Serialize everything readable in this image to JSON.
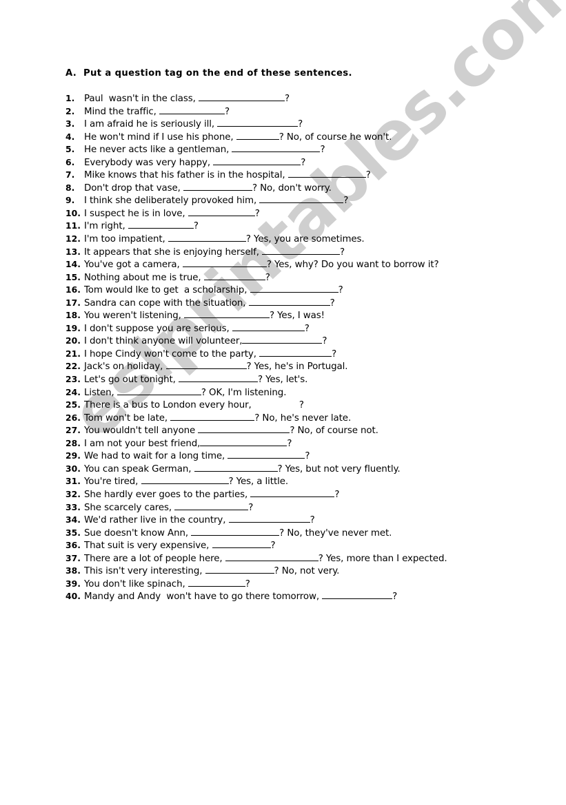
{
  "document": {
    "type": "worksheet",
    "background_color": "#ffffff",
    "text_color": "#000000"
  },
  "watermark": {
    "text": "eslprintables.com",
    "color": "#cfcfcf",
    "rotation_deg": -43,
    "style": "diagonal bold gray"
  },
  "heading": {
    "label": "A.  Put a question tag on the end of these sentences."
  },
  "questions": [
    {
      "num": "1.",
      "num_pad": "1.  ",
      "text": "Paul  wasn't in the class, ",
      "blank_width": 125,
      "tail": "?"
    },
    {
      "num": "2.",
      "num_pad": "2.  ",
      "text": "Mind the traffic, ",
      "blank_width": 95,
      "tail": "?"
    },
    {
      "num": "3.",
      "num_pad": "3.  ",
      "text": "I am afraid he is seriously ill, ",
      "blank_width": 117,
      "tail": "?"
    },
    {
      "num": "4.",
      "num_pad": "4.  ",
      "text": "He won't mind if I use his phone, ",
      "blank_width": 62,
      "tail": "? No, of course he won't."
    },
    {
      "num": "5.",
      "num_pad": "5.  ",
      "text": "He never acts like a gentleman, ",
      "blank_width": 128,
      "tail": "?"
    },
    {
      "num": "6.",
      "num_pad": "6.  ",
      "text": "Everybody was very happy, ",
      "blank_width": 127,
      "tail": "?"
    },
    {
      "num": "7.",
      "num_pad": "7.  ",
      "text": "Mike knows that his father is in the hospital, ",
      "blank_width": 113,
      "tail": "?"
    },
    {
      "num": "8.",
      "num_pad": "8.  ",
      "text": "Don't drop that vase, ",
      "blank_width": 100,
      "tail": "? No, don't worry."
    },
    {
      "num": "9.",
      "num_pad": "9.  ",
      "text": "I think she deliberately provoked him, ",
      "blank_width": 122,
      "tail": "?"
    },
    {
      "num": "10.",
      "num_pad": "10.",
      "text": "I suspect he is in love, ",
      "blank_width": 97,
      "tail": "?"
    },
    {
      "num": "11.",
      "num_pad": "11.",
      "text": "I'm right, ",
      "blank_width": 95,
      "tail": "?"
    },
    {
      "num": "12.",
      "num_pad": "12.",
      "text": "I'm too impatient, ",
      "blank_width": 113,
      "tail": "? Yes, you are sometimes."
    },
    {
      "num": "13.",
      "num_pad": "13.",
      "text": "It appears that she is enjoying herself, ",
      "blank_width": 113,
      "tail": "?"
    },
    {
      "num": "14.",
      "num_pad": "14.",
      "text": "You've got a camera, ",
      "blank_width": 122,
      "tail": "? Yes, why? Do you want to borrow it?"
    },
    {
      "num": "15.",
      "num_pad": "15.",
      "text": "Nothing about me is true, ",
      "blank_width": 89,
      "tail": "?"
    },
    {
      "num": "16.",
      "num_pad": "16.",
      "text": "Tom would lke to get  a scholarship, ",
      "blank_width": 128,
      "tail": "?"
    },
    {
      "num": "17.",
      "num_pad": "17.",
      "text": "Sandra can cope with the situation, ",
      "blank_width": 118,
      "tail": "?"
    },
    {
      "num": "18.",
      "num_pad": "18.",
      "text": "You weren't listening, ",
      "blank_width": 124,
      "tail": "? Yes, I was!"
    },
    {
      "num": "19.",
      "num_pad": "19.",
      "text": "I don't suppose you are serious, ",
      "blank_width": 105,
      "tail": "?"
    },
    {
      "num": "20.",
      "num_pad": "20.",
      "text": "I don't think anyone will volunteer,",
      "blank_width": 116,
      "tail": "?"
    },
    {
      "num": "21.",
      "num_pad": "21.",
      "text": "I hope Cindy won't come to the party, ",
      "blank_width": 105,
      "tail": "?"
    },
    {
      "num": "22.",
      "num_pad": "22.",
      "text": "Jack's on holiday, ",
      "blank_width": 117,
      "tail": "? Yes, he's in Portugal."
    },
    {
      "num": "23.",
      "num_pad": "23.",
      "text": "Let's go out tonight, ",
      "blank_width": 115,
      "tail": "? Yes, let's."
    },
    {
      "num": "24.",
      "num_pad": "24.",
      "text": "Listen, ",
      "blank_width": 122,
      "tail": "? OK, I'm listening."
    },
    {
      "num": "25.",
      "num_pad": "25.",
      "text": "There is a bus to London every hour, ",
      "blank_width": 65,
      "tail": "?",
      "blank_hidden": true
    },
    {
      "num": "26.",
      "num_pad": "26.",
      "text": "Tom won't be late, ",
      "blank_width": 122,
      "tail": "? No, he's never late."
    },
    {
      "num": "27.",
      "num_pad": "27.",
      "text": "You wouldn't tell anyone ",
      "blank_width": 133,
      "tail": "? No, of course not."
    },
    {
      "num": "28.",
      "num_pad": "28.",
      "text": "I am not your best friend,",
      "blank_width": 126,
      "tail": "?"
    },
    {
      "num": "29.",
      "num_pad": "29.",
      "text": "We had to wait for a long time, ",
      "blank_width": 112,
      "tail": "?"
    },
    {
      "num": "30.",
      "num_pad": "30.",
      "text": "You can speak German, ",
      "blank_width": 121,
      "tail": "? Yes, but not very fluently."
    },
    {
      "num": "31.",
      "num_pad": "31.",
      "text": "You're tired, ",
      "blank_width": 127,
      "tail": "? Yes, a little."
    },
    {
      "num": "32.",
      "num_pad": "32.",
      "text": "She hardly ever goes to the parties, ",
      "blank_width": 122,
      "tail": "?"
    },
    {
      "num": "33.",
      "num_pad": "33.",
      "text": "She scarcely cares, ",
      "blank_width": 107,
      "tail": "?"
    },
    {
      "num": "34.",
      "num_pad": "34.",
      "text": "We'd rather live in the country, ",
      "blank_width": 118,
      "tail": "?"
    },
    {
      "num": "35.",
      "num_pad": "35.",
      "text": "Sue doesn't know Ann, ",
      "blank_width": 128,
      "tail": "? No, they've never met."
    },
    {
      "num": "36.",
      "num_pad": "36.",
      "text": "That suit is very expensive, ",
      "blank_width": 85,
      "tail": "?"
    },
    {
      "num": "37.",
      "num_pad": "37.",
      "text": "There are a lot of people here, ",
      "blank_width": 135,
      "tail": "? Yes, more than I expected."
    },
    {
      "num": "38.",
      "num_pad": "38.",
      "text": "This isn't very interesting, ",
      "blank_width": 100,
      "tail": "? No, not very."
    },
    {
      "num": "39.",
      "num_pad": "39.",
      "text": "You don't like spinach, ",
      "blank_width": 83,
      "tail": "?"
    },
    {
      "num": "40.",
      "num_pad": "40.",
      "text": "Mandy and Andy  won't have to go there tomorrow, ",
      "blank_width": 102,
      "tail": "?"
    }
  ]
}
